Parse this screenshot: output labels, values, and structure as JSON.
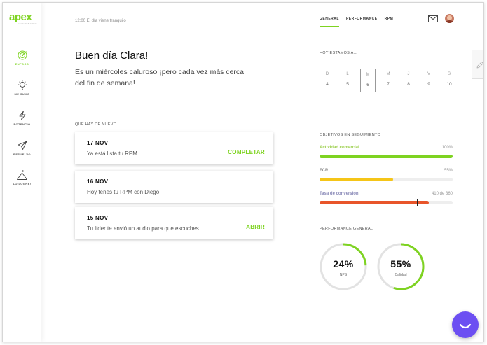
{
  "sidebar": {
    "logo": "apex",
    "logo_sub": "rewards & culture",
    "items": [
      {
        "label": "ENFOCO",
        "icon": "target-icon",
        "active": true
      },
      {
        "label": "ME SUMO",
        "icon": "lightbulb-icon",
        "active": false
      },
      {
        "label": "POTENCIO",
        "icon": "lightning-icon",
        "active": false
      },
      {
        "label": "RESUELVO",
        "icon": "paper-plane-icon",
        "active": false
      },
      {
        "label": "LO LOGRE!",
        "icon": "mountain-flag-icon",
        "active": false
      }
    ]
  },
  "topbar": {
    "time_text": "12:00 El día viene tranquilo",
    "tabs": [
      "GENERAL",
      "PERFORMANCE",
      "RPM"
    ],
    "active_tab": "GENERAL"
  },
  "greeting": {
    "title": "Buen día Clara!",
    "subtitle": "Es un miércoles caluroso ¡pero cada vez más cerca del fin de semana!"
  },
  "news": {
    "title": "QUE HAY DE NUEVO",
    "cards": [
      {
        "date": "17 NOV",
        "text": "Ya está lista tu RPM",
        "action": "COMPLETAR"
      },
      {
        "date": "16 NOV",
        "text": "Hoy tenés tu RPM con Diego",
        "action": ""
      },
      {
        "date": "15 NOV",
        "text": "Tu líder te envió un audio para que escuches",
        "action": "ABRIR"
      }
    ]
  },
  "calendar": {
    "title": "HOY ESTAMOS A...",
    "days": [
      {
        "letter": "D",
        "num": "4"
      },
      {
        "letter": "L",
        "num": "5"
      },
      {
        "letter": "M",
        "num": "6",
        "active": true
      },
      {
        "letter": "M",
        "num": "7"
      },
      {
        "letter": "J",
        "num": "8"
      },
      {
        "letter": "V",
        "num": "9"
      },
      {
        "letter": "S",
        "num": "10"
      }
    ]
  },
  "objectives": {
    "title": "OBJETIVOS EN SEGUIMIENTO",
    "items": [
      {
        "name": "Actividad comercial",
        "value": "100%",
        "fraction": 1.0,
        "color": "#7ed321",
        "name_color": "#9ccf4c"
      },
      {
        "name": "FCR",
        "value": "55%",
        "fraction": 0.55,
        "color": "#f5c518",
        "name_color": "#888888"
      },
      {
        "name": "Tasa de conversión",
        "value": "410 de 360",
        "fraction": 0.82,
        "marker": 0.73,
        "color": "#e8552a",
        "name_color": "#8a8ab8"
      }
    ]
  },
  "performance": {
    "title": "PERFORMANCE GENERAL",
    "gauges": [
      {
        "value": "24%",
        "label": "NPS",
        "fraction": 0.24
      },
      {
        "value": "55%",
        "label": "Calidad",
        "fraction": 0.55
      }
    ]
  },
  "colors": {
    "accent": "#7ed321",
    "chat": "#6c4ff2"
  }
}
